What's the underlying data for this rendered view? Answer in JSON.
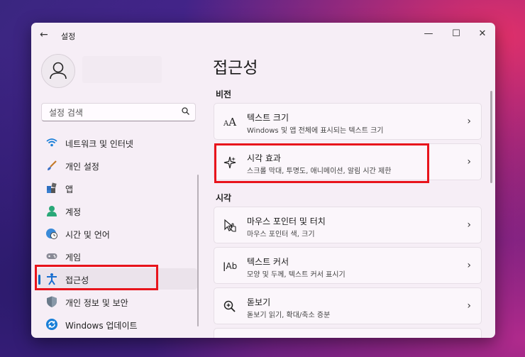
{
  "window": {
    "title": "설정"
  },
  "controls": {
    "minimize": "—",
    "maximize": "☐",
    "close": "✕",
    "back": "←"
  },
  "search": {
    "placeholder": "설정 검색"
  },
  "nav": {
    "items": [
      {
        "label": "네트워크 및 인터넷",
        "icon": "wifi-icon"
      },
      {
        "label": "개인 설정",
        "icon": "brush-icon"
      },
      {
        "label": "앱",
        "icon": "apps-icon"
      },
      {
        "label": "계정",
        "icon": "person-icon"
      },
      {
        "label": "시간 및 언어",
        "icon": "globe-clock-icon"
      },
      {
        "label": "게임",
        "icon": "gamepad-icon"
      },
      {
        "label": "접근성",
        "icon": "accessibility-icon",
        "selected": true
      },
      {
        "label": "개인 정보 및 보안",
        "icon": "shield-icon"
      },
      {
        "label": "Windows 업데이트",
        "icon": "update-icon"
      }
    ]
  },
  "main": {
    "title": "접근성",
    "sections": [
      {
        "heading": "비전",
        "cards": [
          {
            "title": "텍스트 크기",
            "subtitle": "Windows 및 앱 전체에 표시되는 텍스트 크기",
            "icon": "text-size-icon"
          },
          {
            "title": "시각 효과",
            "subtitle": "스크롤 막대, 투명도, 애니메이션, 알림 시간 제한",
            "icon": "sparkle-icon"
          }
        ]
      },
      {
        "heading": "시각",
        "cards": [
          {
            "title": "마우스 포인터 및 터치",
            "subtitle": "마우스 포인터 색, 크기",
            "icon": "pointer-icon"
          },
          {
            "title": "텍스트 커서",
            "subtitle": "모양 및 두께, 텍스트 커서 표시기",
            "icon": "text-cursor-icon"
          },
          {
            "title": "돋보기",
            "subtitle": "돋보기 읽기, 확대/축소 증분",
            "icon": "magnifier-icon"
          }
        ]
      }
    ]
  },
  "colors": {
    "accent": "#0067c0",
    "highlight": "#e8141c"
  }
}
